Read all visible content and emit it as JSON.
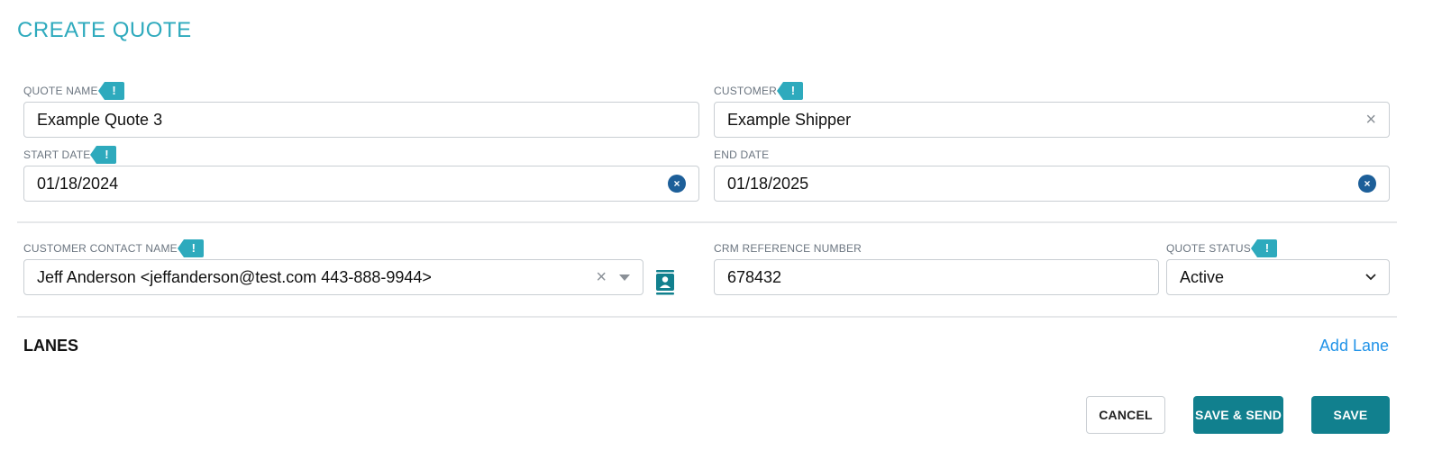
{
  "page": {
    "title": "CREATE QUOTE"
  },
  "required_marker": "!",
  "fields": {
    "quote_name": {
      "label": "QUOTE NAME",
      "value": "Example Quote 3"
    },
    "customer": {
      "label": "CUSTOMER",
      "value": "Example Shipper"
    },
    "start_date": {
      "label": "START DATE",
      "value": "01/18/2024"
    },
    "end_date": {
      "label": "END DATE",
      "value": "01/18/2025"
    },
    "customer_contact": {
      "label": "CUSTOMER CONTACT NAME",
      "value": "Jeff Anderson <jeffanderson@test.com 443-888-9944>"
    },
    "crm_reference": {
      "label": "CRM REFERENCE NUMBER",
      "value": "678432"
    },
    "quote_status": {
      "label": "QUOTE STATUS",
      "value": "Active"
    }
  },
  "icons": {
    "clear": "×",
    "contact_card": "contact-card-icon",
    "chevron": "chevron-down-icon"
  },
  "lanes": {
    "title": "LANES",
    "add_label": "Add Lane"
  },
  "actions": {
    "cancel_label": "CANCEL",
    "save_send_label": "SAVE & SEND",
    "save_label": "SAVE"
  },
  "colors": {
    "accent": "#2eaabd",
    "primary_button": "#11808e",
    "link": "#2193e8",
    "clear_circle": "#1d5f99"
  }
}
